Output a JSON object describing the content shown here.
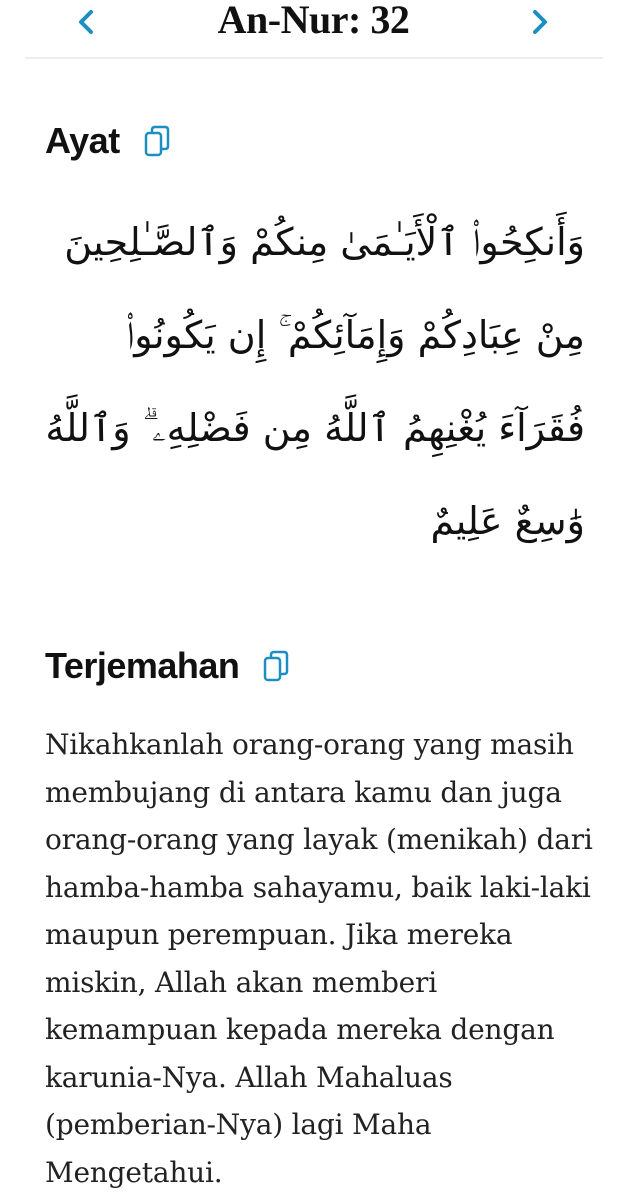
{
  "header": {
    "title": "An-Nur: 32",
    "prev_icon": "chevron-left-icon",
    "next_icon": "chevron-right-icon",
    "accent_color": "#1a8fc0"
  },
  "ayat_section": {
    "heading": "Ayat",
    "copy_icon": "copy-icon",
    "arabic": "وَأَنكِحُوا۟ ٱلْأَيَـٰمَىٰ مِنكُمْ وَٱلصَّـٰلِحِينَ مِنْ عِبَادِكُمْ وَإِمَآئِكُمْ ۚ إِن يَكُونُوا۟ فُقَرَآءَ يُغْنِهِمُ ٱللَّهُ مِن فَضْلِهِۦ ۗ وَٱللَّهُ وَٰسِعٌ عَلِيمٌ"
  },
  "terjemahan_section": {
    "heading": "Terjemahan",
    "copy_icon": "copy-icon",
    "text": "Nikahkanlah orang-orang yang masih membujang di antara kamu dan juga orang-orang yang layak (menikah) dari hamba-hamba sahayamu, baik laki-laki maupun perempuan. Jika mereka miskin, Allah akan memberi kemampuan kepada mereka dengan karunia-Nya. Allah Mahaluas (pemberian-Nya) lagi Maha Mengetahui."
  }
}
